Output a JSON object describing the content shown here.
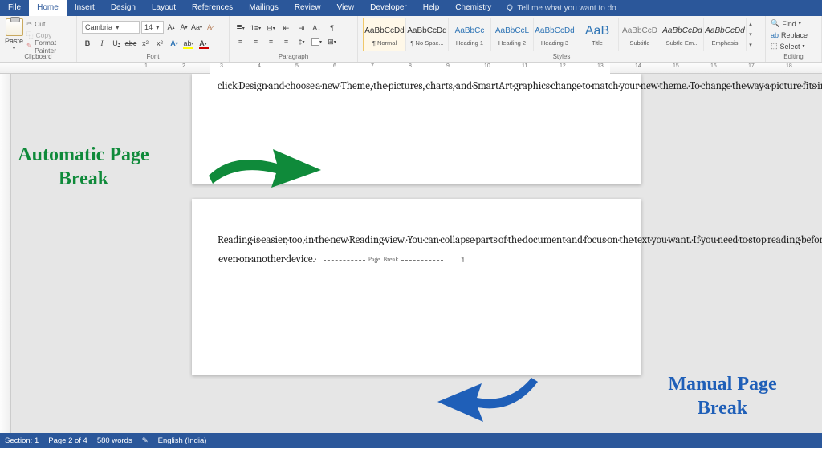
{
  "tabs": {
    "file": "File",
    "home": "Home",
    "insert": "Insert",
    "design": "Design",
    "layout": "Layout",
    "references": "References",
    "mailings": "Mailings",
    "review": "Review",
    "view": "View",
    "developer": "Developer",
    "help": "Help",
    "chemistry": "Chemistry",
    "tellme": "Tell me what you want to do"
  },
  "clipboard": {
    "paste": "Paste",
    "cut": "Cut",
    "copy": "Copy",
    "format_painter": "Format Painter",
    "label": "Clipboard"
  },
  "font": {
    "name": "Cambria",
    "size": "14",
    "label": "Font"
  },
  "paragraph": {
    "label": "Paragraph"
  },
  "styles": {
    "label": "Styles",
    "items": [
      {
        "sample": "AaBbCcDd",
        "name": "¶ Normal"
      },
      {
        "sample": "AaBbCcDd",
        "name": "¶ No Spac..."
      },
      {
        "sample": "AaBbCc",
        "name": "Heading 1"
      },
      {
        "sample": "AaBbCcL",
        "name": "Heading 2"
      },
      {
        "sample": "AaBbCcDd",
        "name": "Heading 3"
      },
      {
        "sample": "AaB",
        "name": "Title"
      },
      {
        "sample": "AaBbCcD",
        "name": "Subtitle"
      },
      {
        "sample": "AaBbCcDd",
        "name": "Subtle Em..."
      },
      {
        "sample": "AaBbCcDd",
        "name": "Emphasis"
      }
    ]
  },
  "editing": {
    "find": "Find",
    "replace": "Replace",
    "select": "Select",
    "label": "Editing"
  },
  "ruler_numbers": [
    "1",
    "2",
    "3",
    "4",
    "5",
    "6",
    "7",
    "8",
    "9",
    "10",
    "11",
    "12",
    "13",
    "14",
    "15",
    "16",
    "17",
    "18"
  ],
  "document": {
    "page1": "click·Design·and·choose·a·new·Theme,·the·pictures,·charts,·and·SmartArt·graphics·change·to·match·your·new·theme.·To·change·the·way·a·picture·fits·in·your·document,·click·it·and·a·button·for·layout·options.¶",
    "page2_text": "Reading·is·easier,·too,·in·the·new·Reading·view.·You·can·collapse·parts·of·the·document·and·focus·on·the·text·you·want.·If·you·need·to·stop·reading·before·you·reach·the·end,·Word·remembers·where·you·left·off·-·even·on·another·device.·",
    "pagebreak_label": "Page Break"
  },
  "annotations": {
    "auto": "Automatic Page Break",
    "manual": "Manual Page Break"
  },
  "status": {
    "section": "Section: 1",
    "page": "Page 2 of 4",
    "words": "580 words",
    "lang": "English (India)"
  }
}
